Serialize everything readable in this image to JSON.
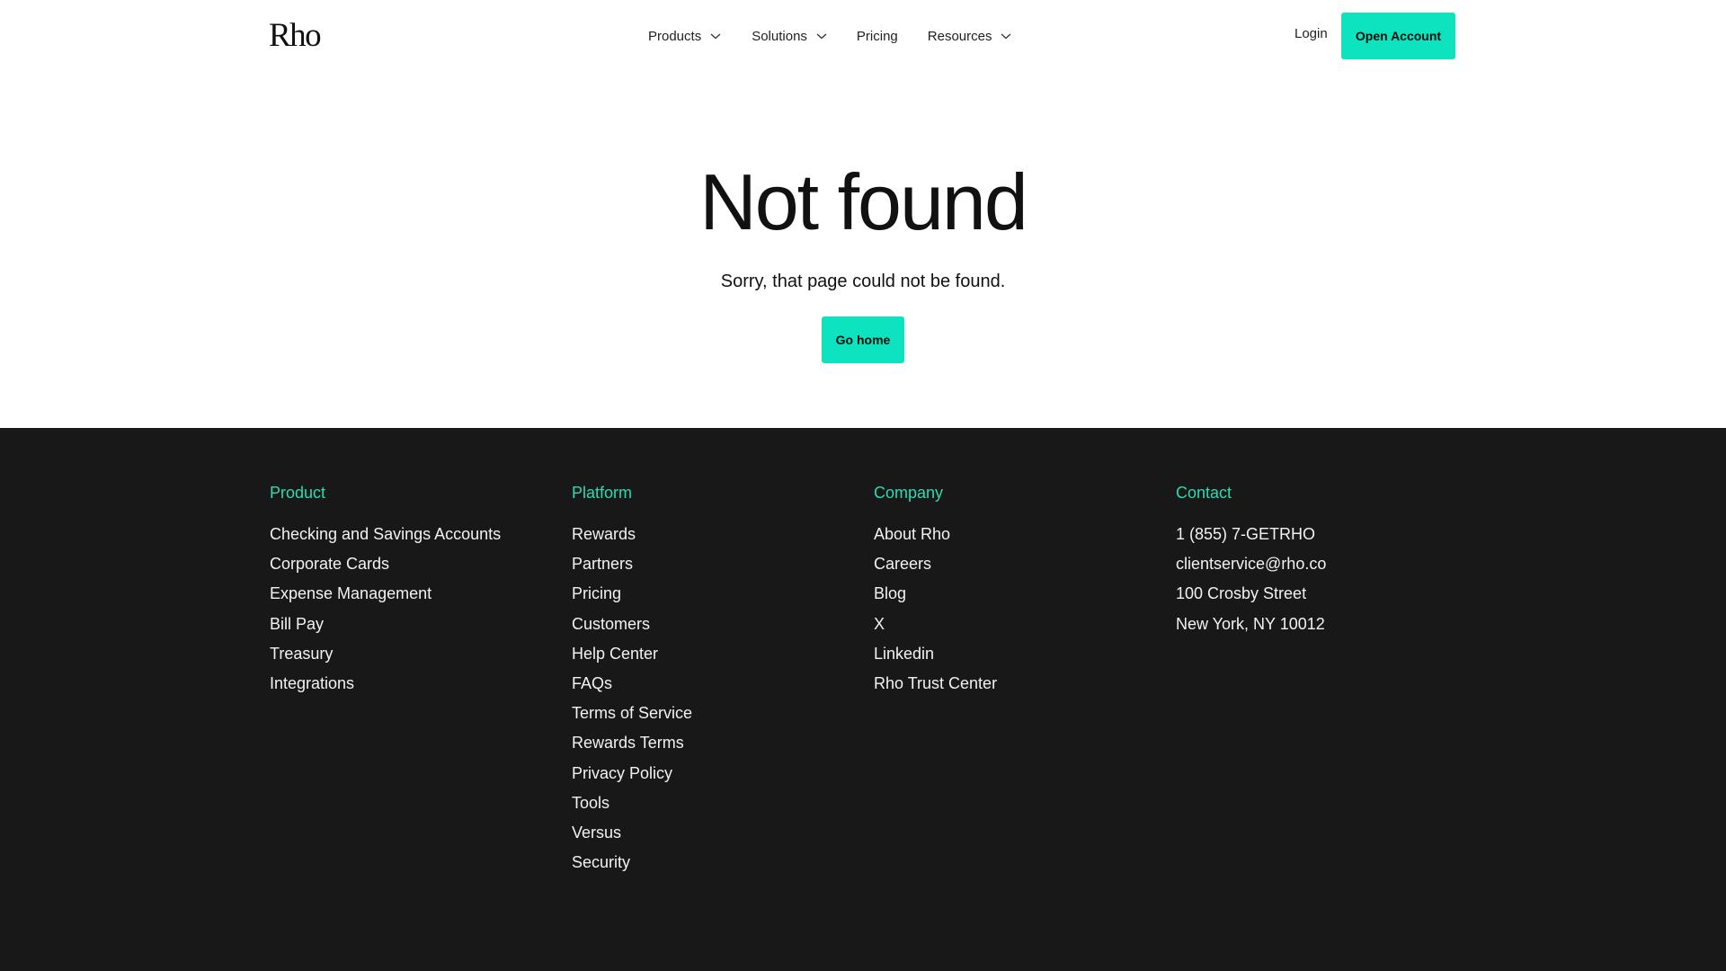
{
  "header": {
    "logo": "Rho",
    "nav": [
      {
        "label": "Products",
        "dropdown": true
      },
      {
        "label": "Solutions",
        "dropdown": true
      },
      {
        "label": "Pricing",
        "dropdown": false
      },
      {
        "label": "Resources",
        "dropdown": true
      }
    ],
    "login_label": "Login",
    "open_account_label": "Open Account"
  },
  "hero": {
    "title": "Not found",
    "subtitle": "Sorry, that page could not be found.",
    "button_label": "Go home"
  },
  "footer": {
    "columns": [
      {
        "title": "Product",
        "links": [
          "Checking and Savings Accounts",
          "Corporate Cards",
          "Expense Management",
          "Bill Pay",
          "Treasury",
          "Integrations"
        ]
      },
      {
        "title": "Platform",
        "links": [
          "Rewards",
          "Partners",
          "Pricing",
          "Customers",
          "Help Center",
          "FAQs",
          "Terms of Service",
          "Rewards Terms",
          "Privacy Policy",
          "Tools",
          "Versus",
          "Security"
        ]
      },
      {
        "title": "Company",
        "links": [
          "About Rho",
          "Careers",
          "Blog",
          "X",
          "Linkedin",
          "Rho Trust Center"
        ]
      },
      {
        "title": "Contact",
        "links": [
          "1 (855) 7-GETRHO",
          "clientservice@rho.co",
          "100 Crosby Street",
          "New York, NY 10012"
        ]
      }
    ]
  },
  "colors": {
    "accent": "#0ee3bf",
    "footer_heading": "#2fd9b2",
    "footer_bg": "#181818"
  }
}
